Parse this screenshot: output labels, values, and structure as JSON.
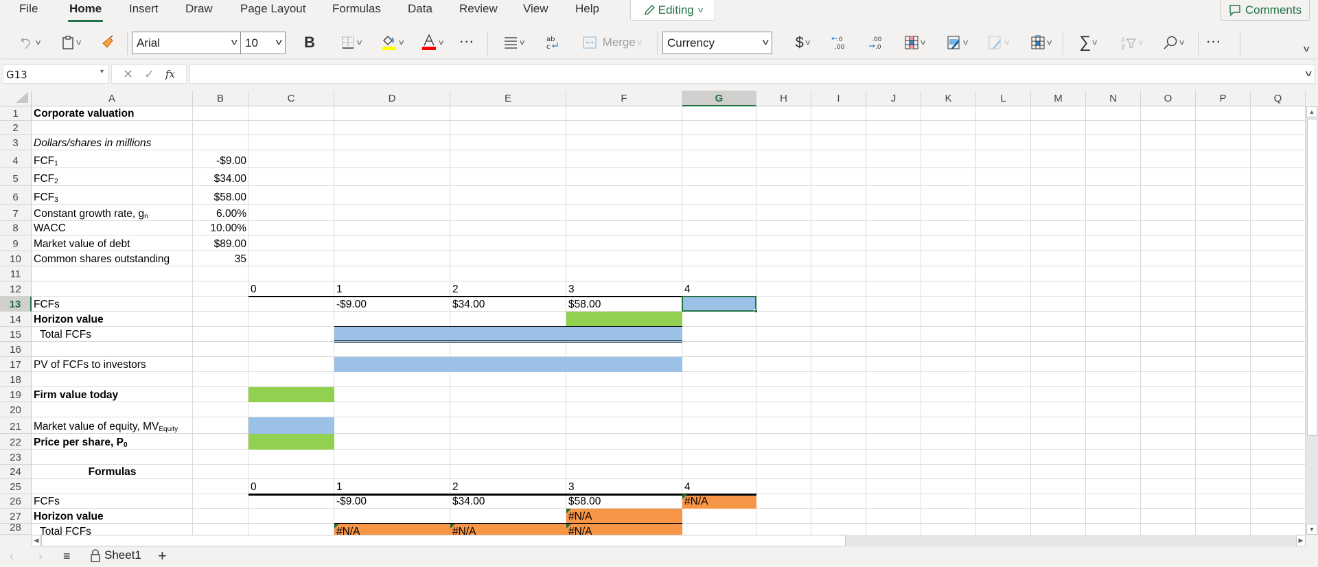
{
  "menu": {
    "items": [
      "File",
      "Home",
      "Insert",
      "Draw",
      "Page Layout",
      "Formulas",
      "Data",
      "Review",
      "View",
      "Help"
    ],
    "active": "Home",
    "editing_label": "Editing",
    "comments_label": "Comments"
  },
  "ribbon": {
    "font_name": "Arial",
    "font_size": "10",
    "bold_label": "B",
    "merge_label": "Merge",
    "number_format": "Currency",
    "currency_symbol": "$",
    "more_label": "···",
    "highlight_color": "#ffff00",
    "font_color": "#ff0000"
  },
  "formula_bar": {
    "name_box": "G13",
    "formula": ""
  },
  "grid": {
    "columns": [
      "A",
      "B",
      "C",
      "D",
      "E",
      "F",
      "G",
      "H",
      "I",
      "J",
      "K",
      "L",
      "M",
      "N",
      "O",
      "P",
      "Q"
    ],
    "selected_column": "G",
    "selected_row": "13",
    "rows": [
      "1",
      "2",
      "3",
      "4",
      "5",
      "6",
      "7",
      "8",
      "9",
      "10",
      "11",
      "12",
      "13",
      "14",
      "15",
      "16",
      "17",
      "18",
      "19",
      "20",
      "21",
      "22",
      "23",
      "24",
      "25",
      "26",
      "27",
      "28"
    ],
    "inputs": {
      "title": "Corporate valuation",
      "units": "Dollars/shares in millions",
      "fcf1_label": "FCF",
      "fcf1_sub": "1",
      "fcf1_value": "-$9.00",
      "fcf2_label": "FCF",
      "fcf2_sub": "2",
      "fcf2_value": "$34.00",
      "fcf3_label": "FCF",
      "fcf3_sub": "3",
      "fcf3_value": "$58.00",
      "growth_label": "Constant growth rate, g",
      "growth_sub": "n",
      "growth_value": "6.00%",
      "wacc_label": "WACC",
      "wacc_value": "10.00%",
      "debt_label": "Market value of debt",
      "debt_value": "$89.00",
      "shares_label": "Common shares outstanding",
      "shares_value": "35"
    },
    "timeline": {
      "periods": [
        "0",
        "1",
        "2",
        "3",
        "4"
      ],
      "fcfs_label": "FCFs",
      "fcfs_values": [
        "-$9.00",
        "$34.00",
        "$58.00"
      ],
      "horizon_label": "Horizon value",
      "total_label": "Total FCFs",
      "pv_label": "PV of FCFs to investors",
      "firm_value_label": "Firm value today",
      "equity_label": "Market value of equity, MV",
      "equity_sub": "Equity",
      "price_label": "Price per share, P",
      "price_sub": "0"
    },
    "formulas": {
      "heading": "Formulas",
      "periods": [
        "0",
        "1",
        "2",
        "3",
        "4"
      ],
      "fcfs_label": "FCFs",
      "fcfs_values": [
        "-$9.00",
        "$34.00",
        "$58.00"
      ],
      "fcf4_value": "#N/A",
      "horizon_label": "Horizon value",
      "horizon_value": "#N/A",
      "total_label": "Total FCFs",
      "total_values": [
        "#N/A",
        "#N/A",
        "#N/A"
      ]
    },
    "colors": {
      "input_green": "#92d050",
      "input_blue": "#9bc2e6",
      "error_orange": "#f79646",
      "accent": "#217346"
    }
  },
  "sheet_tabs": {
    "active": "Sheet1",
    "add_label": "+"
  }
}
